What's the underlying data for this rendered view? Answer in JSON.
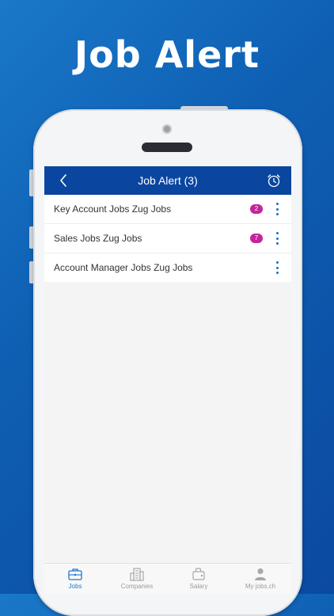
{
  "promo": {
    "title": "Job Alert"
  },
  "nav": {
    "title": "Job Alert (3)"
  },
  "alerts": [
    {
      "label": "Key Account Jobs Zug Jobs",
      "count": "2"
    },
    {
      "label": "Sales Jobs Zug Jobs",
      "count": "7"
    },
    {
      "label": "Account Manager Jobs Zug Jobs",
      "count": ""
    }
  ],
  "tabs": [
    {
      "label": "Jobs",
      "icon": "briefcase-icon",
      "active": true
    },
    {
      "label": "Companies",
      "icon": "building-icon",
      "active": false
    },
    {
      "label": "Salary",
      "icon": "wallet-icon",
      "active": false
    },
    {
      "label": "My jobs.ch",
      "icon": "person-icon",
      "active": false
    }
  ],
  "colors": {
    "nav_bg": "#0a46a0",
    "badge": "#c4249c",
    "accent": "#1f78c8",
    "kebab": "#1a6fc0"
  }
}
